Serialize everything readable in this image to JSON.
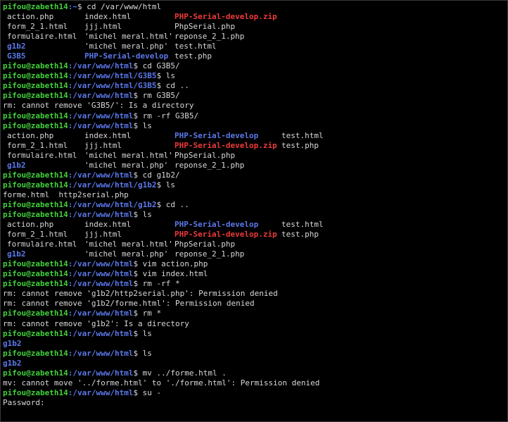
{
  "colors": {
    "background": "#000000",
    "text": "#d8d8d8",
    "prompt_user": "#41d13a",
    "prompt_path": "#5b78e9",
    "directory": "#5b78e9",
    "archive": "#ee3a3a"
  },
  "lines": [
    {
      "t": "prompt",
      "user": "pifou@zabeth14",
      "path": ":~",
      "cmd": "$ cd /var/www/html"
    },
    {
      "t": "grid",
      "cells": [
        {
          "s": "action.php",
          "c": "f"
        },
        {
          "s": "index.html",
          "c": "f"
        },
        {
          "s": "PHP-Serial-develop.zip",
          "c": "z"
        }
      ]
    },
    {
      "t": "grid",
      "cells": [
        {
          "s": "form_2_1.html",
          "c": "f"
        },
        {
          "s": "jjj.html",
          "c": "f"
        },
        {
          "s": "PhpSerial.php",
          "c": "f"
        }
      ]
    },
    {
      "t": "grid",
      "cells": [
        {
          "s": "formulaire.html",
          "c": "f"
        },
        {
          "s": "'michel meral.html'",
          "c": "f"
        },
        {
          "s": "reponse_2_1.php",
          "c": "f"
        }
      ]
    },
    {
      "t": "grid",
      "cells": [
        {
          "s": "g1b2",
          "c": "d"
        },
        {
          "s": "'michel meral.php'",
          "c": "f"
        },
        {
          "s": "test.html",
          "c": "f"
        }
      ]
    },
    {
      "t": "grid",
      "cells": [
        {
          "s": "G3B5",
          "c": "d"
        },
        {
          "s": "PHP-Serial-develop",
          "c": "d"
        },
        {
          "s": "test.php",
          "c": "f"
        }
      ]
    },
    {
      "t": "prompt",
      "user": "pifou@zabeth14",
      "path": ":/var/www/html",
      "cmd": "$ cd G3B5/"
    },
    {
      "t": "prompt",
      "user": "pifou@zabeth14",
      "path": ":/var/www/html/G3B5",
      "cmd": "$ ls"
    },
    {
      "t": "prompt",
      "user": "pifou@zabeth14",
      "path": ":/var/www/html/G3B5",
      "cmd": "$ cd .."
    },
    {
      "t": "prompt",
      "user": "pifou@zabeth14",
      "path": ":/var/www/html",
      "cmd": "$ rm G3B5/"
    },
    {
      "t": "out",
      "s": "rm: cannot remove 'G3B5/': Is a directory"
    },
    {
      "t": "prompt",
      "user": "pifou@zabeth14",
      "path": ":/var/www/html",
      "cmd": "$ rm -rf G3B5/"
    },
    {
      "t": "prompt",
      "user": "pifou@zabeth14",
      "path": ":/var/www/html",
      "cmd": "$ ls"
    },
    {
      "t": "grid",
      "cells": [
        {
          "s": "action.php",
          "c": "f"
        },
        {
          "s": "index.html",
          "c": "f"
        },
        {
          "s": "PHP-Serial-develop",
          "c": "d"
        },
        {
          "s": "test.html",
          "c": "f"
        }
      ]
    },
    {
      "t": "grid",
      "cells": [
        {
          "s": "form_2_1.html",
          "c": "f"
        },
        {
          "s": "jjj.html",
          "c": "f"
        },
        {
          "s": "PHP-Serial-develop.zip",
          "c": "z"
        },
        {
          "s": "test.php",
          "c": "f"
        }
      ]
    },
    {
      "t": "grid",
      "cells": [
        {
          "s": "formulaire.html",
          "c": "f"
        },
        {
          "s": "'michel meral.html'",
          "c": "f"
        },
        {
          "s": "PhpSerial.php",
          "c": "f"
        }
      ]
    },
    {
      "t": "grid",
      "cells": [
        {
          "s": "g1b2",
          "c": "d"
        },
        {
          "s": "'michel meral.php'",
          "c": "f"
        },
        {
          "s": "reponse_2_1.php",
          "c": "f"
        }
      ]
    },
    {
      "t": "prompt",
      "user": "pifou@zabeth14",
      "path": ":/var/www/html",
      "cmd": "$ cd g1b2/"
    },
    {
      "t": "prompt",
      "user": "pifou@zabeth14",
      "path": ":/var/www/html/g1b2",
      "cmd": "$ ls"
    },
    {
      "t": "out",
      "s": "forme.html  http2serial.php"
    },
    {
      "t": "prompt",
      "user": "pifou@zabeth14",
      "path": ":/var/www/html/g1b2",
      "cmd": "$ cd .."
    },
    {
      "t": "prompt",
      "user": "pifou@zabeth14",
      "path": ":/var/www/html",
      "cmd": "$ ls"
    },
    {
      "t": "grid",
      "cells": [
        {
          "s": "action.php",
          "c": "f"
        },
        {
          "s": "index.html",
          "c": "f"
        },
        {
          "s": "PHP-Serial-develop",
          "c": "d"
        },
        {
          "s": "test.html",
          "c": "f"
        }
      ]
    },
    {
      "t": "grid",
      "cells": [
        {
          "s": "form_2_1.html",
          "c": "f"
        },
        {
          "s": "jjj.html",
          "c": "f"
        },
        {
          "s": "PHP-Serial-develop.zip",
          "c": "z"
        },
        {
          "s": "test.php",
          "c": "f"
        }
      ]
    },
    {
      "t": "grid",
      "cells": [
        {
          "s": "formulaire.html",
          "c": "f"
        },
        {
          "s": "'michel meral.html'",
          "c": "f"
        },
        {
          "s": "PhpSerial.php",
          "c": "f"
        }
      ]
    },
    {
      "t": "grid",
      "cells": [
        {
          "s": "g1b2",
          "c": "d"
        },
        {
          "s": "'michel meral.php'",
          "c": "f"
        },
        {
          "s": "reponse_2_1.php",
          "c": "f"
        }
      ]
    },
    {
      "t": "prompt",
      "user": "pifou@zabeth14",
      "path": ":/var/www/html",
      "cmd": "$ vim action.php"
    },
    {
      "t": "prompt",
      "user": "pifou@zabeth14",
      "path": ":/var/www/html",
      "cmd": "$ vim index.html"
    },
    {
      "t": "prompt",
      "user": "pifou@zabeth14",
      "path": ":/var/www/html",
      "cmd": "$ rm -rf *"
    },
    {
      "t": "out",
      "s": "rm: cannot remove 'g1b2/http2serial.php': Permission denied"
    },
    {
      "t": "out",
      "s": "rm: cannot remove 'g1b2/forme.html': Permission denied"
    },
    {
      "t": "prompt",
      "user": "pifou@zabeth14",
      "path": ":/var/www/html",
      "cmd": "$ rm *"
    },
    {
      "t": "out",
      "s": "rm: cannot remove 'g1b2': Is a directory"
    },
    {
      "t": "prompt",
      "user": "pifou@zabeth14",
      "path": ":/var/www/html",
      "cmd": "$ ls"
    },
    {
      "t": "diro",
      "s": "g1b2"
    },
    {
      "t": "prompt",
      "user": "pifou@zabeth14",
      "path": ":/var/www/html",
      "cmd": "$ ls"
    },
    {
      "t": "diro",
      "s": "g1b2"
    },
    {
      "t": "prompt",
      "user": "pifou@zabeth14",
      "path": ":/var/www/html",
      "cmd": "$ mv ../forme.html ."
    },
    {
      "t": "out",
      "s": "mv: cannot move '../forme.html' to './forme.html': Permission denied"
    },
    {
      "t": "prompt",
      "user": "pifou@zabeth14",
      "path": ":/var/www/html",
      "cmd": "$ su -"
    },
    {
      "t": "out",
      "s": "Password:"
    }
  ]
}
